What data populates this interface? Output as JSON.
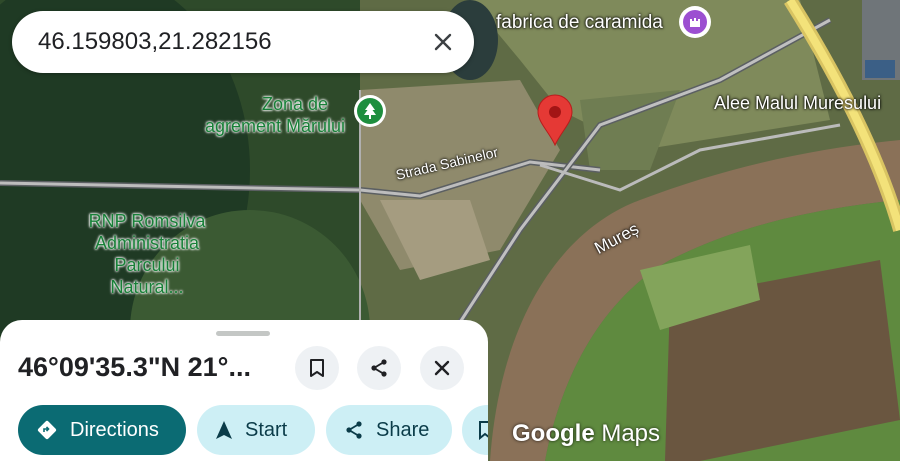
{
  "search": {
    "value": "46.159803,21.282156"
  },
  "map": {
    "labels": {
      "fabrica": "fabrica de caramida",
      "zona_line1": "Zona de",
      "zona_line2": "agrement Mărului",
      "alee": "Alee Malul Muresului",
      "strada": "Strada Sabinelor",
      "rnp_line1": "RNP Romsilva",
      "rnp_line2": "Administratia",
      "rnp_line3": "Parcului",
      "rnp_line4": "Natural...",
      "river": "Mureș"
    },
    "attribution": {
      "google": "Google",
      "maps": "Maps"
    },
    "icons": {
      "pin": "red-location-pin-icon",
      "park": "park-tree-icon",
      "castle": "castle-icon"
    }
  },
  "sheet": {
    "title": "46°09'35.3\"N 21°...",
    "actions": {
      "directions": "Directions",
      "start": "Start",
      "share": "Share"
    }
  },
  "colors": {
    "primary_chip": "#0b6b73",
    "secondary_chip": "#cdeff5",
    "pin": "#e53935",
    "green_label": "#188038"
  }
}
